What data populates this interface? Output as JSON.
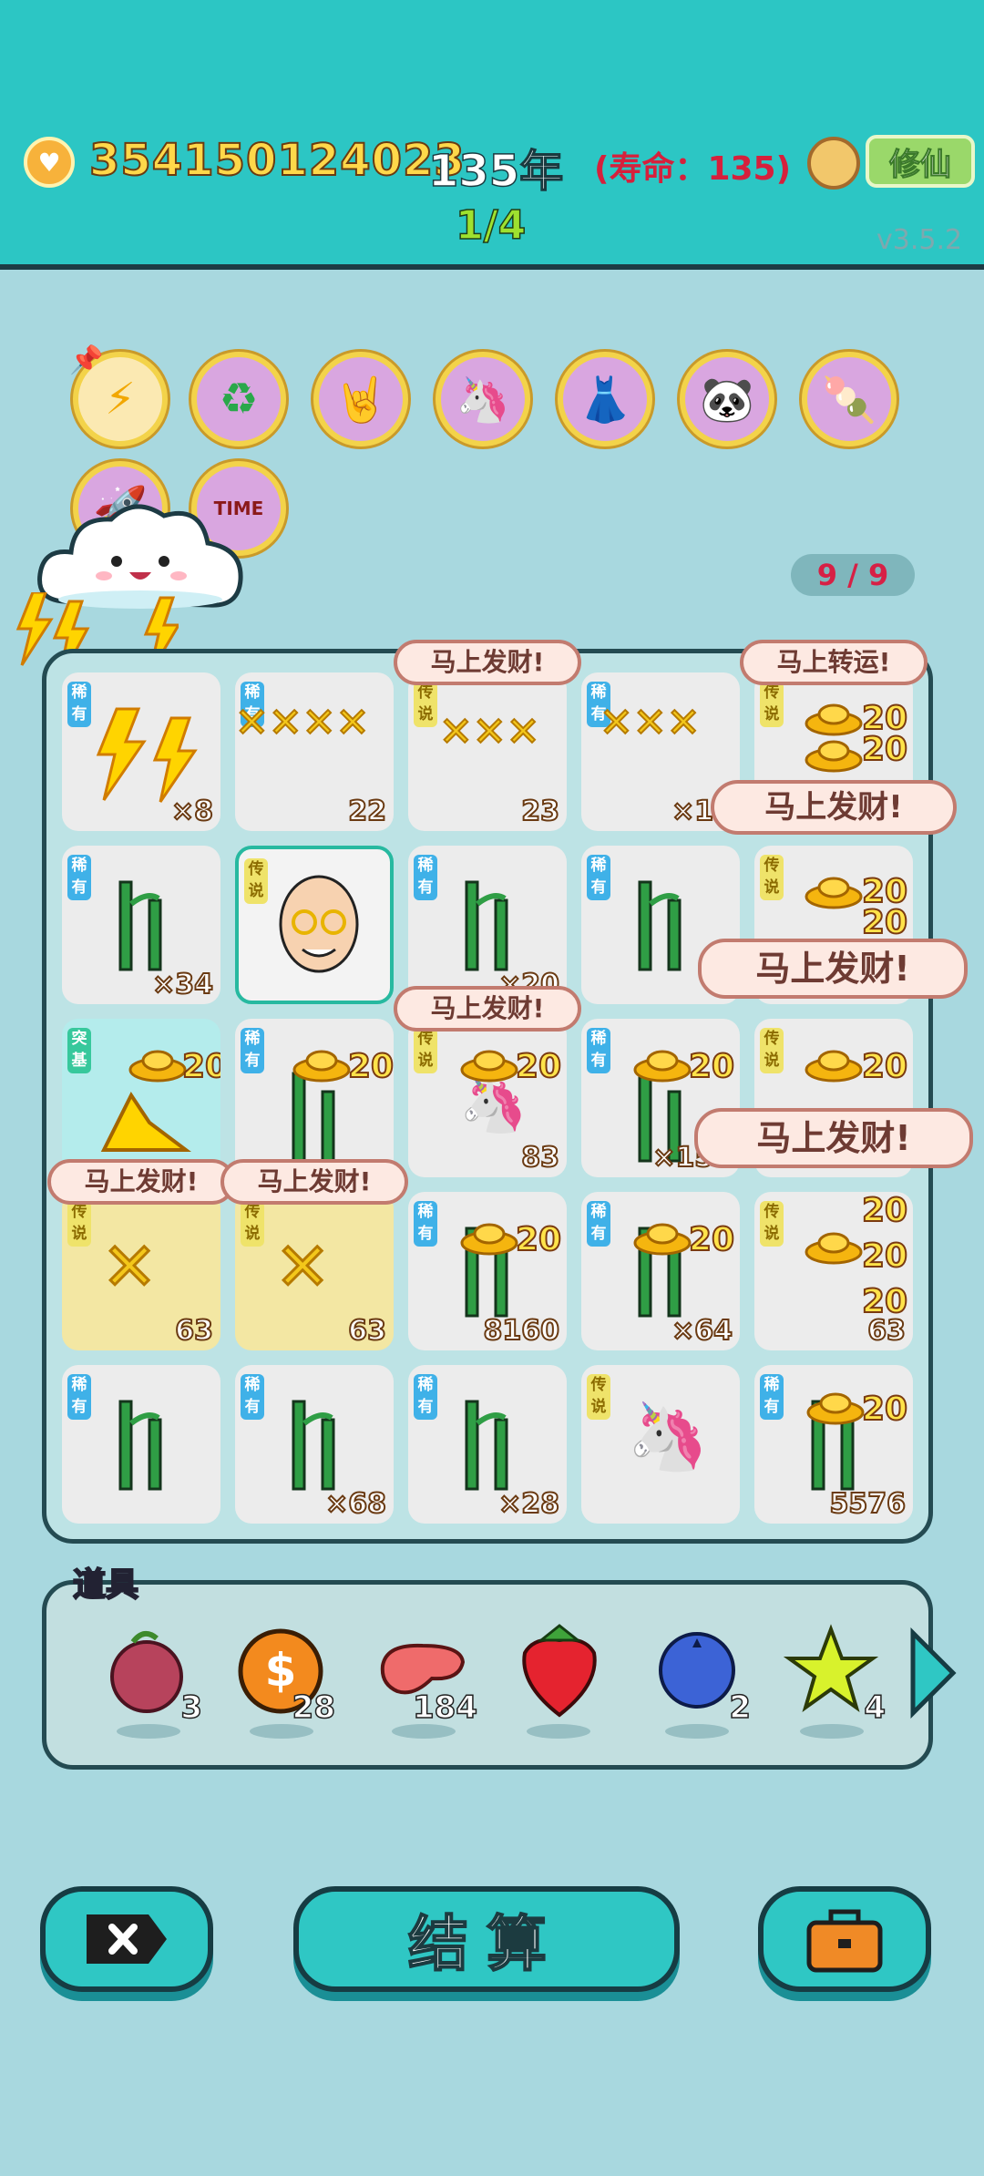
{
  "header": {
    "coins": "354150124023",
    "years": "135年",
    "lifespan": "(寿命：135)",
    "cultivate_label": "修仙",
    "round": "1/4",
    "version": "v3.5.2"
  },
  "relics": [
    {
      "icon": "lightning-icon"
    },
    {
      "icon": "recycle-icon"
    },
    {
      "icon": "rock-hand-icon"
    },
    {
      "icon": "unicorn-icon"
    },
    {
      "icon": "skirt-icon"
    },
    {
      "icon": "panda-icon"
    },
    {
      "icon": "sticker-icon"
    },
    {
      "icon": "rocket-icon"
    },
    {
      "icon": "time-magazine-icon"
    }
  ],
  "relic_counter": "9 / 9",
  "board": {
    "tags": {
      "rare": "稀有",
      "legend": "传说",
      "epic": "突基"
    },
    "bonus": "20",
    "bubbles": [
      "马上发财!",
      "马上转运!",
      "马上发财!",
      "马上发财!",
      "马上发财!",
      "马上发财!",
      "马上发财!",
      "马上发财!"
    ],
    "counts": [
      "×8",
      "22",
      "23",
      "×10",
      "×34",
      "×20",
      "83",
      "×151",
      "63",
      "63",
      "8160",
      "×64",
      "63",
      "×68",
      "×28",
      "5576"
    ]
  },
  "items": {
    "label": "道具",
    "list": [
      {
        "icon": "lychee-icon",
        "qty": "3"
      },
      {
        "icon": "coin-icon",
        "qty": "28"
      },
      {
        "icon": "liver-icon",
        "qty": "184"
      },
      {
        "icon": "strawberry-icon",
        "qty": ""
      },
      {
        "icon": "blueberry-icon",
        "qty": "2"
      },
      {
        "icon": "star-icon",
        "qty": "4"
      }
    ]
  },
  "buttons": {
    "settle": "结算"
  }
}
